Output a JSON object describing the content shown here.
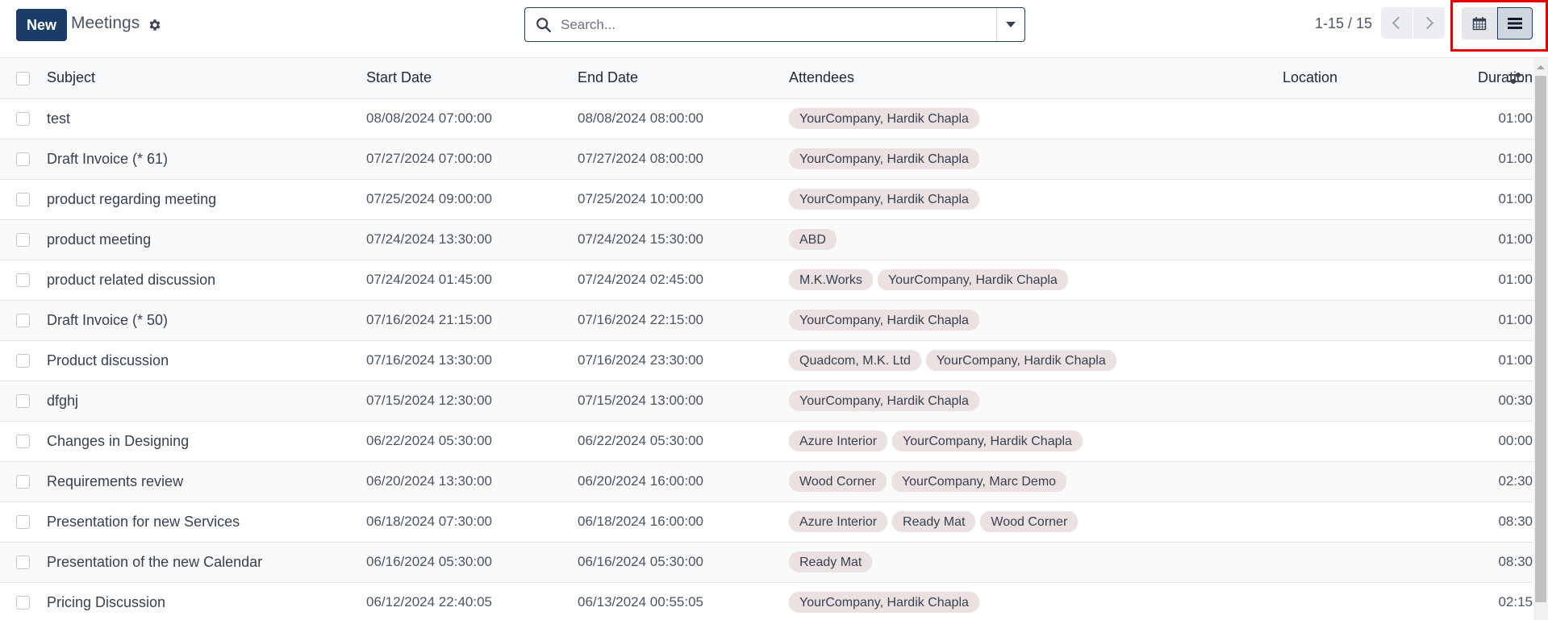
{
  "control_panel": {
    "new_label": "New",
    "title": "Meetings",
    "search_placeholder": "Search...",
    "pager": "1-15 / 15"
  },
  "views": [
    {
      "name": "calendar",
      "icon": "calendar-icon",
      "active": false
    },
    {
      "name": "list",
      "icon": "list-icon",
      "active": true
    }
  ],
  "colors": {
    "primary": "#1a3d68",
    "tag_bg": "#ebe1e1",
    "highlight": "#e00000"
  },
  "table": {
    "columns": [
      "Subject",
      "Start Date",
      "End Date",
      "Attendees",
      "Location",
      "Duration"
    ],
    "rows": [
      {
        "subject": "test",
        "start": "08/08/2024 07:00:00",
        "end": "08/08/2024 08:00:00",
        "attendees": [
          "YourCompany, Hardik Chapla"
        ],
        "location": "",
        "duration": "01:00"
      },
      {
        "subject": "Draft Invoice (* 61)",
        "start": "07/27/2024 07:00:00",
        "end": "07/27/2024 08:00:00",
        "attendees": [
          "YourCompany, Hardik Chapla"
        ],
        "location": "",
        "duration": "01:00"
      },
      {
        "subject": "product regarding meeting",
        "start": "07/25/2024 09:00:00",
        "end": "07/25/2024 10:00:00",
        "attendees": [
          "YourCompany, Hardik Chapla"
        ],
        "location": "",
        "duration": "01:00"
      },
      {
        "subject": "product meeting",
        "start": "07/24/2024 13:30:00",
        "end": "07/24/2024 15:30:00",
        "attendees": [
          "ABD"
        ],
        "location": "",
        "duration": "01:00"
      },
      {
        "subject": "product related discussion",
        "start": "07/24/2024 01:45:00",
        "end": "07/24/2024 02:45:00",
        "attendees": [
          "M.K.Works",
          "YourCompany, Hardik Chapla"
        ],
        "location": "",
        "duration": "01:00"
      },
      {
        "subject": "Draft Invoice (* 50)",
        "start": "07/16/2024 21:15:00",
        "end": "07/16/2024 22:15:00",
        "attendees": [
          "YourCompany, Hardik Chapla"
        ],
        "location": "",
        "duration": "01:00"
      },
      {
        "subject": "Product discussion",
        "start": "07/16/2024 13:30:00",
        "end": "07/16/2024 23:30:00",
        "attendees": [
          "Quadcom, M.K. Ltd",
          "YourCompany, Hardik Chapla"
        ],
        "location": "",
        "duration": "01:00"
      },
      {
        "subject": "dfghj",
        "start": "07/15/2024 12:30:00",
        "end": "07/15/2024 13:00:00",
        "attendees": [
          "YourCompany, Hardik Chapla"
        ],
        "location": "",
        "duration": "00:30"
      },
      {
        "subject": "Changes in Designing",
        "start": "06/22/2024 05:30:00",
        "end": "06/22/2024 05:30:00",
        "attendees": [
          "Azure Interior",
          "YourCompany, Hardik Chapla"
        ],
        "location": "",
        "duration": "00:00"
      },
      {
        "subject": "Requirements review",
        "start": "06/20/2024 13:30:00",
        "end": "06/20/2024 16:00:00",
        "attendees": [
          "Wood Corner",
          "YourCompany, Marc Demo"
        ],
        "location": "",
        "duration": "02:30"
      },
      {
        "subject": "Presentation for new Services",
        "start": "06/18/2024 07:30:00",
        "end": "06/18/2024 16:00:00",
        "attendees": [
          "Azure Interior",
          "Ready Mat",
          "Wood Corner"
        ],
        "location": "",
        "duration": "08:30"
      },
      {
        "subject": "Presentation of the new Calendar",
        "start": "06/16/2024 05:30:00",
        "end": "06/16/2024 05:30:00",
        "attendees": [
          "Ready Mat"
        ],
        "location": "",
        "duration": "08:30"
      },
      {
        "subject": "Pricing Discussion",
        "start": "06/12/2024 22:40:05",
        "end": "06/13/2024 00:55:05",
        "attendees": [
          "YourCompany, Hardik Chapla"
        ],
        "location": "",
        "duration": "02:15"
      }
    ]
  }
}
